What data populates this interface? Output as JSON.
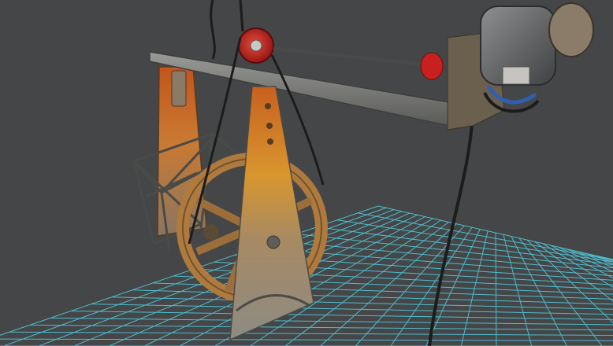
{
  "viewport": {
    "background": "#454647",
    "grid_color": "#4fd2e6",
    "object_name": "",
    "shading": "textured"
  },
  "colors": {
    "rust_orange": "#d9822b",
    "rust_yellow": "#e0a23a",
    "metal_grey": "#8f8f8a",
    "metal_dark": "#5c5d5a",
    "pulley_red": "#c8201f",
    "belt_black": "#1c1c1c",
    "motor_grey": "#6e7072",
    "wire_blue": "#2f5fae"
  },
  "icons": [
    "gear-icon"
  ]
}
